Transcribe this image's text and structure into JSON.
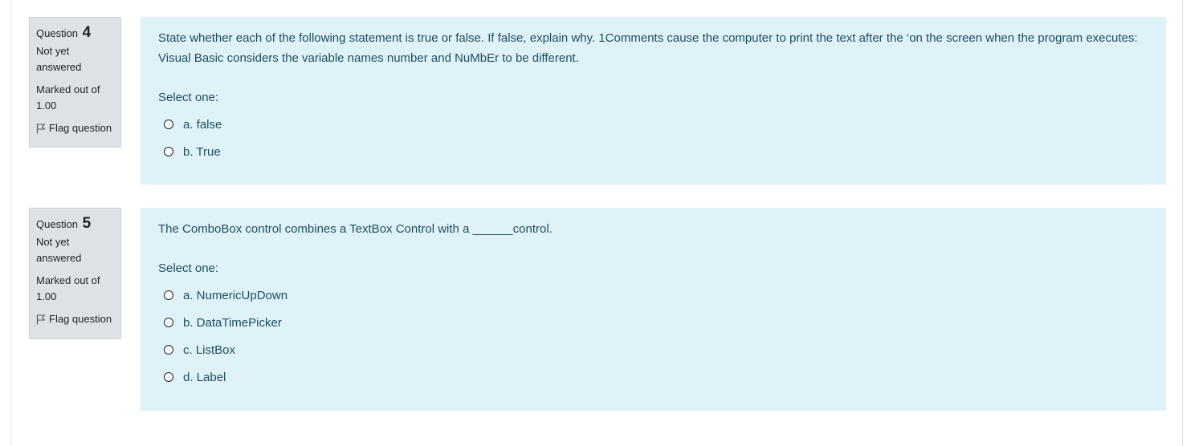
{
  "questions": [
    {
      "label": "Question",
      "number": "4",
      "state": "Not yet answered",
      "grade": "Marked out of 1.00",
      "flag_label": "Flag question",
      "text": "State whether each of the following statement is true or false. If false, explain why. 1Comments cause the computer to print the text after the ‘on the screen when the program executes: Visual Basic considers the variable names number and NuMbEr to be different.",
      "prompt": "Select one:",
      "answers": [
        "a. false",
        "b. True"
      ]
    },
    {
      "label": "Question",
      "number": "5",
      "state": "Not yet answered",
      "grade": "Marked out of 1.00",
      "flag_label": "Flag question",
      "text": "The ComboBox control combines a TextBox Control with a ______control.",
      "prompt": "Select one:",
      "answers": [
        "a. NumericUpDown",
        "b. DataTimePicker",
        "c. ListBox",
        "d. Label"
      ]
    }
  ]
}
